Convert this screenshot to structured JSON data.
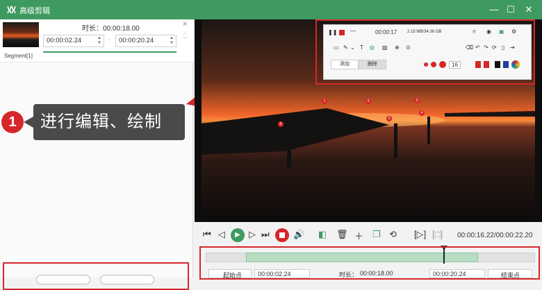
{
  "window": {
    "title": "高级剪辑",
    "minimize_label": "—",
    "maximize_label": "☐",
    "close_label": "✕"
  },
  "segment": {
    "duration_label": "时长：",
    "duration_value": "00:00:18.00",
    "start_time": "00:00:02.24",
    "end_time": "00:00:20.24",
    "separator": "-",
    "label": "Segment[1]"
  },
  "callout": {
    "number": "1",
    "text": "进行编辑、绘制"
  },
  "draw_toolbar": {
    "time": "00:00:17",
    "size_info": "2.15 MB/34.36 GB",
    "tab1": "添加",
    "tab2": "删除",
    "width_value": "16"
  },
  "markers": [
    "1",
    "2",
    "3",
    "4",
    "5",
    "6"
  ],
  "playback": {
    "current_time": "00:00:16.22/00:00:22.20"
  },
  "timeline": {
    "start_btn": "起始点",
    "start_time": "00:00:02.24",
    "duration_label": "时长：",
    "duration_value": "00:00:18.00",
    "end_time": "00:00:20.24",
    "end_btn": "结束点"
  },
  "colors": {
    "title_bar": "#3f9a61",
    "highlight": "#d6262a",
    "play": "#3f9a61",
    "stop": "#d6262a"
  }
}
